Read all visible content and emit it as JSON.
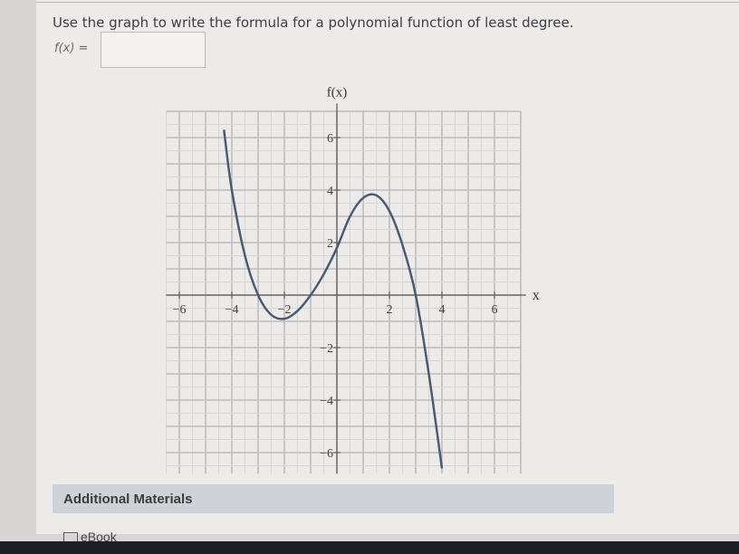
{
  "question": {
    "text": "Use the graph to write the formula for a polynomial function of least degree.",
    "fx_label": "f(x) =",
    "answer_value": ""
  },
  "graph": {
    "y_axis_label": "f(x)",
    "x_axis_label": "x",
    "x_tick_labels": [
      "−6",
      "−4",
      "−2",
      "2",
      "4",
      "6"
    ],
    "y_tick_labels": [
      "6",
      "4",
      "2",
      "−2",
      "−4",
      "−6"
    ],
    "curve_color": "#4b5c70"
  },
  "chart_data": {
    "type": "line",
    "title": "",
    "xlabel": "x",
    "ylabel": "f(x)",
    "xlim": [
      -6.5,
      7
    ],
    "ylim": [
      -7,
      7
    ],
    "grid": true,
    "x_ticks": [
      -6,
      -4,
      -2,
      2,
      4,
      6
    ],
    "y_ticks": [
      -6,
      -4,
      -2,
      2,
      4,
      6
    ],
    "series": [
      {
        "x": [
          -4.3,
          -4.0,
          -3.5,
          -3.0,
          -2.5,
          -2.0,
          -1.5,
          -1.0,
          -0.5,
          0.0,
          0.5,
          1.0,
          1.5,
          2.0,
          2.5,
          3.0,
          3.5,
          4.0
        ],
        "values": [
          6.3,
          4.0,
          1.5,
          0.0,
          -0.75,
          -0.9,
          -0.6,
          0.0,
          0.8,
          1.8,
          3.0,
          3.7,
          3.8,
          3.2,
          1.9,
          0.0,
          -3.0,
          -6.6
        ]
      }
    ]
  },
  "materials": {
    "title": "Additional Materials",
    "ebook_label": "eBook"
  }
}
